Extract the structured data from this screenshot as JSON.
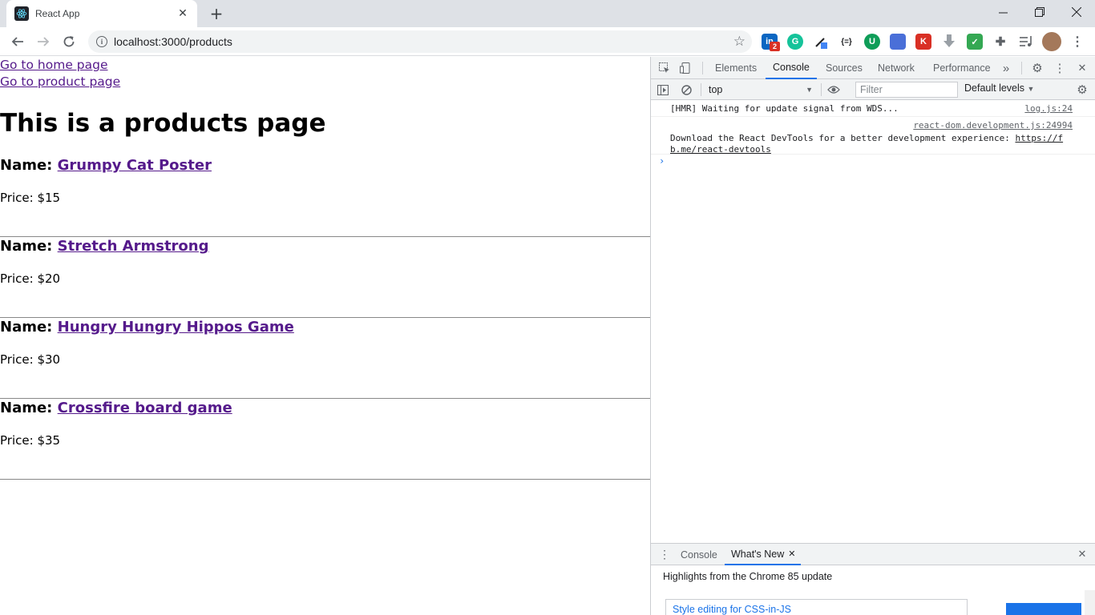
{
  "browser": {
    "tab_title": "React App",
    "url": "localhost:3000/products",
    "extension_badge": "2"
  },
  "page": {
    "nav_links": [
      "Go to home page",
      "Go to product page"
    ],
    "heading": "This is a products page",
    "name_label": "Name:",
    "price_label": "Price:",
    "products": [
      {
        "name": "Grumpy Cat Poster",
        "price": "$15"
      },
      {
        "name": "Stretch Armstrong",
        "price": "$20"
      },
      {
        "name": "Hungry Hungry Hippos Game",
        "price": "$30"
      },
      {
        "name": "Crossfire board game",
        "price": "$35"
      }
    ]
  },
  "devtools": {
    "tabs": [
      "Elements",
      "Console",
      "Sources",
      "Network",
      "Performance"
    ],
    "active_tab": "Console",
    "context": "top",
    "filter_placeholder": "Filter",
    "levels": "Default levels",
    "logs": [
      {
        "text": "[HMR] Waiting for update signal from WDS...",
        "source": "log.js:24"
      },
      {
        "text": "Download the React DevTools for a better development experience: ",
        "link": "https://fb.me/react-devtools",
        "source": "react-dom.development.js:24994"
      }
    ],
    "drawer_tabs": [
      "Console",
      "What's New"
    ],
    "drawer_heading": "Highlights from the Chrome 85 update",
    "drawer_card": "Style editing for CSS-in-JS"
  },
  "colors": {
    "link_visited": "#551a8b",
    "devtools_accent": "#1a73e8"
  }
}
